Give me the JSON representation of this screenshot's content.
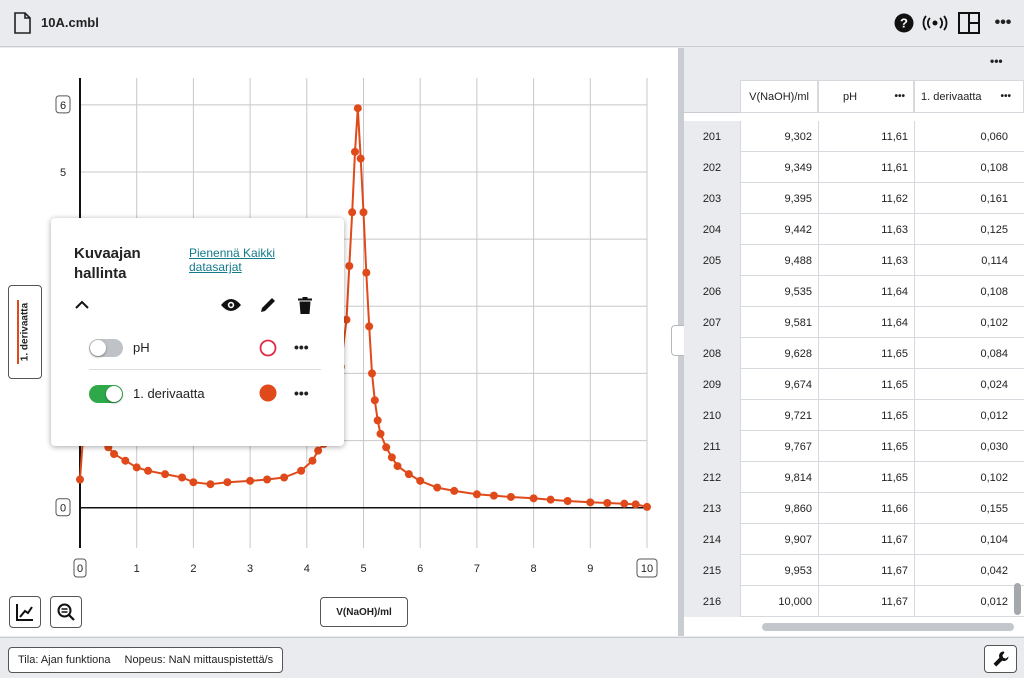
{
  "header": {
    "file_name": "10A.cmbl",
    "icons": [
      "file-icon",
      "help-icon",
      "wireless-sensor-icon",
      "layout-icon",
      "more-icon"
    ]
  },
  "graph": {
    "y_axis_button_label": "1. derivaatta",
    "x_axis_button_label": "V(NaOH)/ml",
    "tools": [
      "graph-tools-icon",
      "zoom-icon"
    ]
  },
  "panel": {
    "title": "Kuvaajan hallinta",
    "link": "Pienennä Kaikki datasarjat",
    "series": [
      {
        "name": "pH",
        "enabled": false,
        "color": "#e02b4a",
        "marker": "hollow"
      },
      {
        "name": "1. derivaatta",
        "enabled": true,
        "color": "#e04a1a",
        "marker": "filled"
      }
    ]
  },
  "chart_data": {
    "type": "scatter",
    "series": [
      {
        "name": "1. derivaatta",
        "x": [
          0,
          0.05,
          0.1,
          0.2,
          0.3,
          0.4,
          0.5,
          0.6,
          0.8,
          1.0,
          1.2,
          1.5,
          1.8,
          2.0,
          2.3,
          2.6,
          3.0,
          3.3,
          3.6,
          3.9,
          4.1,
          4.2,
          4.3,
          4.4,
          4.5,
          4.6,
          4.7,
          4.75,
          4.8,
          4.85,
          4.9,
          4.95,
          5.0,
          5.05,
          5.1,
          5.15,
          5.2,
          5.25,
          5.3,
          5.4,
          5.5,
          5.6,
          5.8,
          6.0,
          6.3,
          6.6,
          7.0,
          7.3,
          7.6,
          8.0,
          8.3,
          8.6,
          9.0,
          9.3,
          9.6,
          9.8,
          10.0
        ],
        "y": [
          0.42,
          1.0,
          1.6,
          1.8,
          1.7,
          1.2,
          0.9,
          0.8,
          0.7,
          0.6,
          0.55,
          0.5,
          0.45,
          0.38,
          0.35,
          0.38,
          0.4,
          0.42,
          0.45,
          0.55,
          0.7,
          0.85,
          0.95,
          1.2,
          1.6,
          2.1,
          2.8,
          3.6,
          4.4,
          5.3,
          5.95,
          5.2,
          4.4,
          3.5,
          2.7,
          2.0,
          1.6,
          1.3,
          1.1,
          0.9,
          0.75,
          0.62,
          0.5,
          0.4,
          0.3,
          0.25,
          0.2,
          0.18,
          0.16,
          0.14,
          0.12,
          0.1,
          0.08,
          0.07,
          0.06,
          0.05,
          0.012
        ]
      }
    ],
    "x_ticks": [
      0,
      1,
      2,
      3,
      4,
      5,
      6,
      7,
      8,
      9,
      10
    ],
    "y_ticks": [
      0,
      5,
      6
    ],
    "xlim": [
      0,
      10
    ],
    "ylim": [
      -0.6,
      6.4
    ],
    "grid": true
  },
  "table": {
    "columns": [
      "V(NaOH)/ml",
      "pH",
      "1. derivaatta"
    ],
    "rows": [
      [
        "201",
        "9,302",
        "11,61",
        "0,060"
      ],
      [
        "202",
        "9,349",
        "11,61",
        "0,108"
      ],
      [
        "203",
        "9,395",
        "11,62",
        "0,161"
      ],
      [
        "204",
        "9,442",
        "11,63",
        "0,125"
      ],
      [
        "205",
        "9,488",
        "11,63",
        "0,114"
      ],
      [
        "206",
        "9,535",
        "11,64",
        "0,108"
      ],
      [
        "207",
        "9,581",
        "11,64",
        "0,102"
      ],
      [
        "208",
        "9,628",
        "11,65",
        "0,084"
      ],
      [
        "209",
        "9,674",
        "11,65",
        "0,024"
      ],
      [
        "210",
        "9,721",
        "11,65",
        "0,012"
      ],
      [
        "211",
        "9,767",
        "11,65",
        "0,030"
      ],
      [
        "212",
        "9,814",
        "11,65",
        "0,102"
      ],
      [
        "213",
        "9,860",
        "11,66",
        "0,155"
      ],
      [
        "214",
        "9,907",
        "11,67",
        "0,104"
      ],
      [
        "215",
        "9,953",
        "11,67",
        "0,042"
      ],
      [
        "216",
        "10,000",
        "11,67",
        "0,012"
      ]
    ]
  },
  "status": {
    "mode_text": "Tila: Ajan funktiona",
    "rate_text": "Nopeus: NaN mittauspistettä/s"
  }
}
